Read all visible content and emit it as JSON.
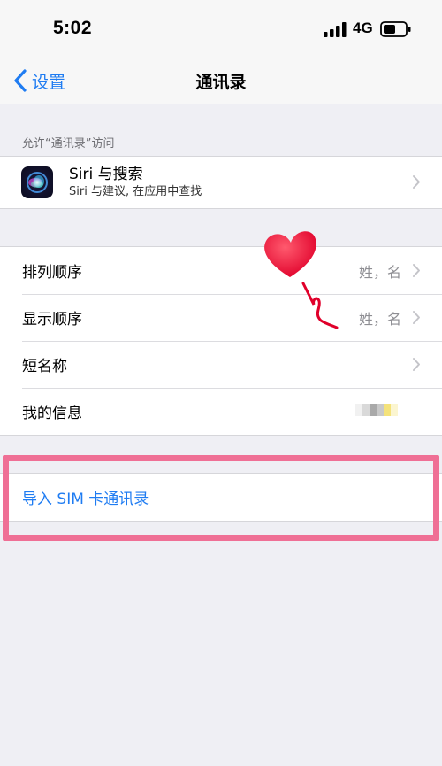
{
  "status_bar": {
    "time": "5:02",
    "network": "4G",
    "icons": [
      "signal-bars-icon",
      "battery-icon"
    ]
  },
  "nav": {
    "back_label": "设置",
    "title": "通讯录",
    "accent_color": "#1f7cf2"
  },
  "section_header": "允许“通讯录”访问",
  "siri": {
    "title": "Siri 与搜索",
    "subtitle": "Siri 与建议, 在应用中查找",
    "icon": "siri-icon"
  },
  "settings": {
    "sort_order": {
      "label": "排列顺序",
      "value": "姓，名"
    },
    "display_order": {
      "label": "显示顺序",
      "value": "姓，名"
    },
    "short_name": {
      "label": "短名称"
    },
    "my_info": {
      "label": "我的信息"
    }
  },
  "import": {
    "label": "导入 SIM 卡通讯录"
  },
  "decorations": {
    "highlight_color": "#ef6f95",
    "sticker": "heart-sticker"
  }
}
